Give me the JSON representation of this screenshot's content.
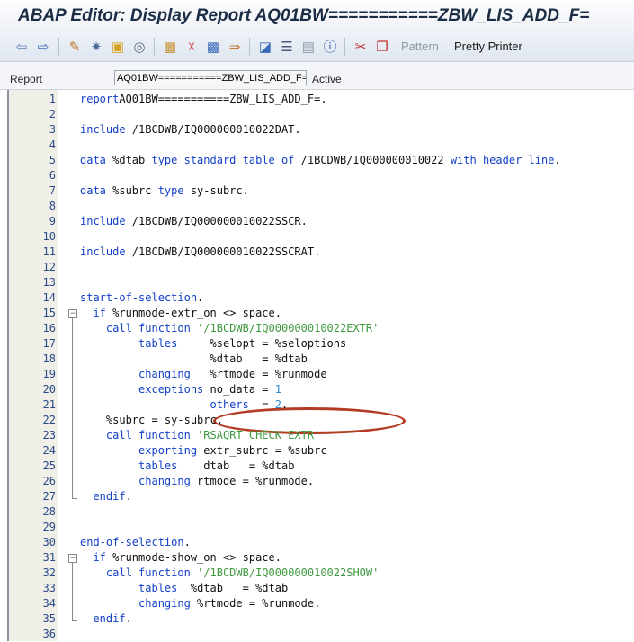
{
  "window": {
    "title": "ABAP Editor: Display Report AQ01BW===========ZBW_LIS_ADD_F="
  },
  "toolbar": {
    "icons": [
      "back-arrow-icon",
      "forward-arrow-icon",
      "other-object-icon",
      "display-change-icon",
      "active-inactive-icon",
      "check-icon",
      "activate-icon",
      "test-icon",
      "where-used-icon",
      "object-list-icon",
      "navigation-window-icon",
      "hierarchy-icon",
      "enhance-icon",
      "info-icon",
      "cut-icon",
      "copy-icon",
      "paste-icon"
    ],
    "pattern_label": "Pattern",
    "pretty_printer_label": "Pretty Printer"
  },
  "info": {
    "report_label": "Report",
    "report_value": "AQ01BW===========ZBW_LIS_ADD_F=",
    "status": "Active"
  },
  "lines": [
    {
      "n": "1",
      "t": [
        [
          "kw",
          "report"
        ],
        [
          "",
          "AQ01BW===========ZBW_LIS_ADD_F=."
        ]
      ]
    },
    {
      "n": "2",
      "t": []
    },
    {
      "n": "3",
      "t": [
        [
          "kw",
          "include"
        ],
        [
          "",
          " /1BCDWB/IQ000000010022DAT."
        ]
      ]
    },
    {
      "n": "4",
      "t": []
    },
    {
      "n": "5",
      "t": [
        [
          "kw",
          "data"
        ],
        [
          "",
          " %dtab "
        ],
        [
          "kw",
          "type standard table of"
        ],
        [
          "",
          " /1BCDWB/IQ000000010022 "
        ],
        [
          "kw",
          "with header line"
        ],
        [
          "",
          "."
        ]
      ]
    },
    {
      "n": "6",
      "t": []
    },
    {
      "n": "7",
      "t": [
        [
          "kw",
          "data"
        ],
        [
          "",
          " %subrc "
        ],
        [
          "kw",
          "type"
        ],
        [
          "",
          " sy-subrc."
        ]
      ]
    },
    {
      "n": "8",
      "t": []
    },
    {
      "n": "9",
      "t": [
        [
          "kw",
          "include"
        ],
        [
          "",
          " /1BCDWB/IQ000000010022SSCR."
        ]
      ]
    },
    {
      "n": "10",
      "t": []
    },
    {
      "n": "11",
      "t": [
        [
          "kw",
          "include"
        ],
        [
          "",
          " /1BCDWB/IQ000000010022SSCRAT."
        ]
      ]
    },
    {
      "n": "12",
      "t": []
    },
    {
      "n": "13",
      "t": []
    },
    {
      "n": "14",
      "t": [
        [
          "kw",
          "start-of-selection"
        ],
        [
          "",
          "."
        ]
      ]
    },
    {
      "n": "15",
      "t": [
        [
          "",
          "  "
        ],
        [
          "kw",
          "if"
        ],
        [
          "",
          " %runmode-extr_on <> space."
        ]
      ]
    },
    {
      "n": "16",
      "t": [
        [
          "",
          "    "
        ],
        [
          "kw",
          "call function"
        ],
        [
          "",
          " "
        ],
        [
          "str",
          "'/1BCDWB/IQ000000010022EXTR'"
        ]
      ]
    },
    {
      "n": "17",
      "t": [
        [
          "",
          "         "
        ],
        [
          "kw",
          "tables"
        ],
        [
          "",
          "     %selopt = %seloptions"
        ]
      ]
    },
    {
      "n": "18",
      "t": [
        [
          "",
          "                    %dtab   = %dtab"
        ]
      ]
    },
    {
      "n": "19",
      "t": [
        [
          "",
          "         "
        ],
        [
          "kw",
          "changing"
        ],
        [
          "",
          "   %rtmode = %runmode"
        ]
      ]
    },
    {
      "n": "20",
      "t": [
        [
          "",
          "         "
        ],
        [
          "kw",
          "exceptions"
        ],
        [
          "",
          " no_data = "
        ],
        [
          "num",
          "1"
        ]
      ]
    },
    {
      "n": "21",
      "t": [
        [
          "",
          "                    "
        ],
        [
          "kw",
          "others"
        ],
        [
          "",
          "  = "
        ],
        [
          "num",
          "2"
        ],
        [
          "",
          "."
        ]
      ]
    },
    {
      "n": "22",
      "t": [
        [
          "",
          "    %subrc = sy-subrc."
        ]
      ]
    },
    {
      "n": "23",
      "t": [
        [
          "",
          "    "
        ],
        [
          "kw",
          "call function"
        ],
        [
          "",
          " "
        ],
        [
          "str",
          "'RSAQRT_CHECK_EXTR'"
        ]
      ]
    },
    {
      "n": "24",
      "t": [
        [
          "",
          "         "
        ],
        [
          "kw",
          "exporting"
        ],
        [
          "",
          " extr_subrc = %subrc"
        ]
      ]
    },
    {
      "n": "25",
      "t": [
        [
          "",
          "         "
        ],
        [
          "kw",
          "tables"
        ],
        [
          "",
          "    dtab   = %dtab"
        ]
      ]
    },
    {
      "n": "26",
      "t": [
        [
          "",
          "         "
        ],
        [
          "kw",
          "changing"
        ],
        [
          "",
          " rtmode = %runmode."
        ]
      ]
    },
    {
      "n": "27",
      "t": [
        [
          "",
          "  "
        ],
        [
          "kw",
          "endif"
        ],
        [
          "",
          "."
        ]
      ]
    },
    {
      "n": "28",
      "t": []
    },
    {
      "n": "29",
      "t": []
    },
    {
      "n": "30",
      "t": [
        [
          "kw",
          "end-of-selection"
        ],
        [
          "",
          "."
        ]
      ]
    },
    {
      "n": "31",
      "t": [
        [
          "",
          "  "
        ],
        [
          "kw",
          "if"
        ],
        [
          "",
          " %runmode-show_on <> space."
        ]
      ]
    },
    {
      "n": "32",
      "t": [
        [
          "",
          "    "
        ],
        [
          "kw",
          "call function"
        ],
        [
          "",
          " "
        ],
        [
          "str",
          "'/1BCDWB/IQ000000010022SHOW'"
        ]
      ]
    },
    {
      "n": "33",
      "t": [
        [
          "",
          "         "
        ],
        [
          "kw",
          "tables"
        ],
        [
          "",
          "  %dtab   = %dtab"
        ]
      ]
    },
    {
      "n": "34",
      "t": [
        [
          "",
          "         "
        ],
        [
          "kw",
          "changing"
        ],
        [
          "",
          " %rtmode = %runmode."
        ]
      ]
    },
    {
      "n": "35",
      "t": [
        [
          "",
          "  "
        ],
        [
          "kw",
          "endif"
        ],
        [
          "",
          "."
        ]
      ]
    },
    {
      "n": "36",
      "t": []
    }
  ]
}
